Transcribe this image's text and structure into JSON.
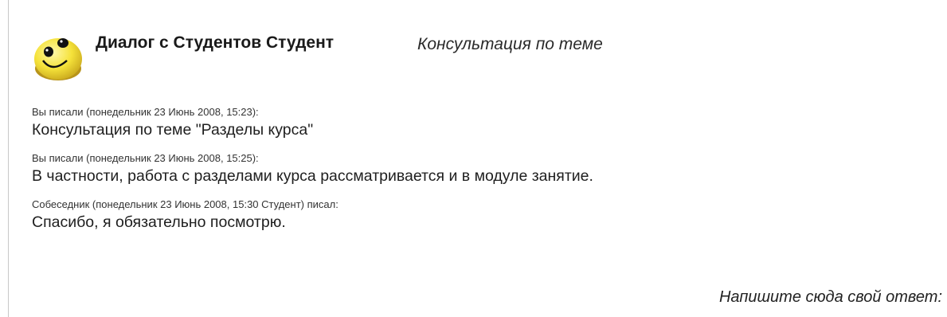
{
  "header": {
    "title": "Диалог с Студентов Студент",
    "subject": "Консультация по теме",
    "avatar_icon": "smiley-face-icon"
  },
  "messages": [
    {
      "meta": "Вы писали (понедельник 23 Июнь 2008, 15:23):",
      "text": "Консультация по теме \"Разделы курса\""
    },
    {
      "meta": "Вы писали (понедельник 23 Июнь 2008, 15:25):",
      "text": "В частности, работа с разделами курса рассматривается и в модуле занятие."
    },
    {
      "meta": "Собеседник (понедельник 23 Июнь 2008, 15:30 Студент) писал:",
      "text": "Спасибо, я обязательно посмотрю."
    }
  ],
  "reply": {
    "prompt": "Напишите сюда свой ответ:"
  },
  "colors": {
    "avatar_yellow": "#f5e23a",
    "avatar_shadow": "#c9a81c",
    "text": "#1e1e1e",
    "rule": "#c8c8c8"
  }
}
